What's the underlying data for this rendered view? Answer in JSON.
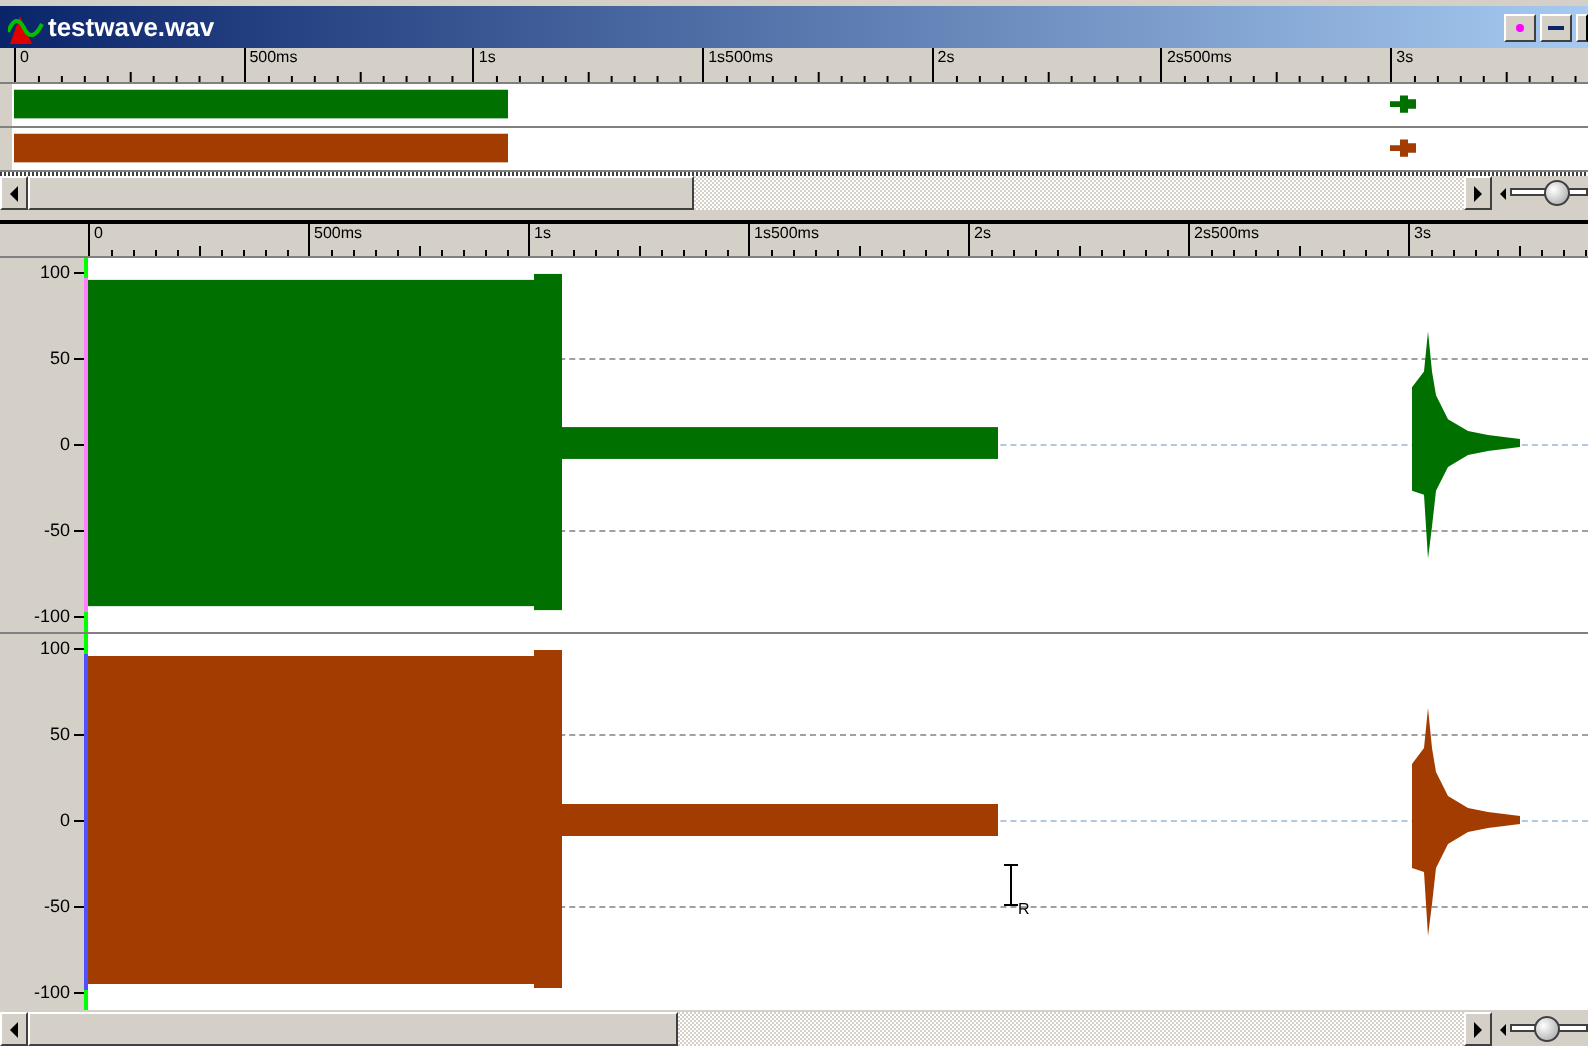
{
  "window": {
    "title": "testwave.wav"
  },
  "overview": {
    "ruler": [
      "0",
      "500ms",
      "1s",
      "1s500ms",
      "2s",
      "2s500ms",
      "3s"
    ],
    "tracks": [
      {
        "color": "#007000"
      },
      {
        "color": "#a33c00"
      }
    ],
    "scrollbar": {
      "zoom": {
        "level": 0.6
      }
    }
  },
  "main": {
    "ruler": [
      "0",
      "500ms",
      "1s",
      "1s500ms",
      "2s",
      "2s500ms",
      "3s"
    ],
    "channels": [
      {
        "color": "#007000",
        "y_labels": [
          "100",
          "50",
          "0",
          "-50",
          "-100"
        ]
      },
      {
        "color": "#a33c00",
        "y_labels": [
          "100",
          "50",
          "0",
          "-50",
          "-100"
        ]
      }
    ],
    "cursor": {
      "channel": "R"
    },
    "scrollbar": {
      "zoom": {
        "level": 0.45
      }
    }
  }
}
